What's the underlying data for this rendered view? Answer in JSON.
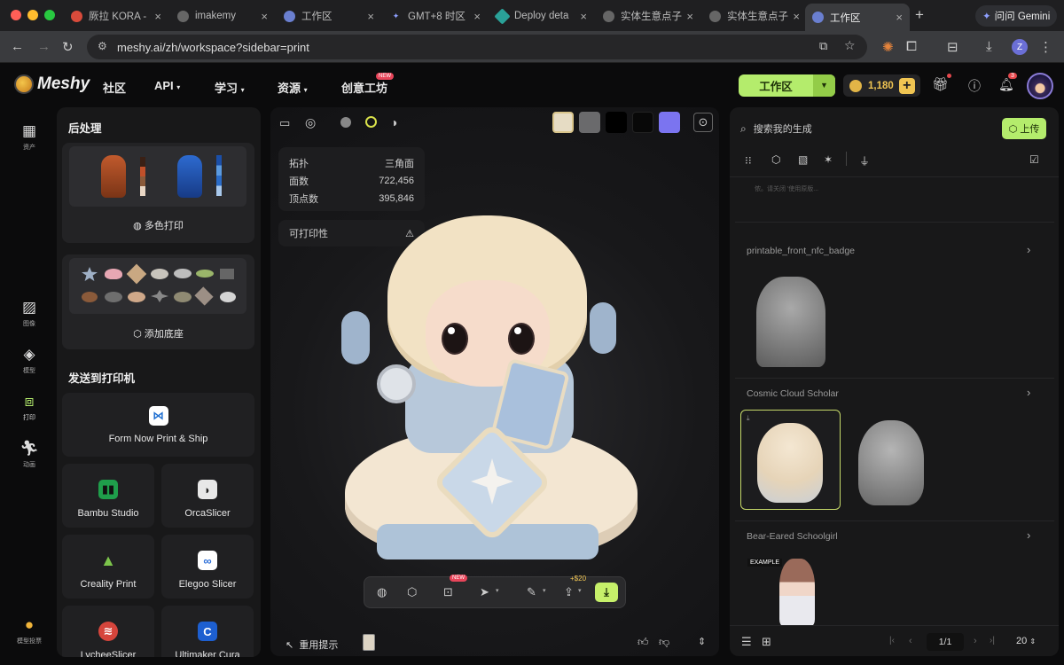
{
  "browser": {
    "tabs": [
      {
        "label": "厥拉 KORA -",
        "color": "#d94b3b"
      },
      {
        "label": "imakemy",
        "color": "#888"
      },
      {
        "label": "工作区",
        "color": "#6a7fd0"
      },
      {
        "label": "GMT+8 时区",
        "color": "#7b8cf0"
      },
      {
        "label": "Deploy deta",
        "color": "#2aa198"
      },
      {
        "label": "实体生意点子",
        "color": "#888"
      },
      {
        "label": "实体生意点子",
        "color": "#888"
      },
      {
        "label": "工作区",
        "color": "#6a7fd0"
      }
    ],
    "new_tab": "+",
    "gemini": "问问 Gemini",
    "url": "meshy.ai/zh/workspace?sidebar=print",
    "profile_initial": "Z"
  },
  "header": {
    "logo": "Meshy",
    "menu": [
      "社区",
      "API",
      "学习",
      "资源",
      "创意工坊"
    ],
    "menu_new_badge": "NEW",
    "workspace_button": "工作区",
    "credits": "1,180",
    "notif_count": "3"
  },
  "rail": {
    "items": [
      {
        "label": "资产",
        "icon": "grid-icon"
      },
      {
        "label": "图像",
        "icon": "image-icon"
      },
      {
        "label": "模型",
        "icon": "cube-icon"
      },
      {
        "label": "打印",
        "icon": "print-icon"
      },
      {
        "label": "动画",
        "icon": "run-icon"
      },
      {
        "label": "模型投票",
        "icon": "vote-icon"
      }
    ]
  },
  "left_panel": {
    "post_title": "后处理",
    "multicolor": "多色打印",
    "add_base": "添加底座",
    "send_title": "发送到打印机",
    "form_now": "Form Now Print & Ship",
    "slicers": [
      "Bambu Studio",
      "OrcaSlicer",
      "Creality Print",
      "Elegoo Slicer",
      "LycheeSlicer",
      "Ultimaker Cura"
    ]
  },
  "viewer": {
    "stats": [
      {
        "label": "拓扑",
        "value": "三角面"
      },
      {
        "label": "面数",
        "value": "722,456"
      },
      {
        "label": "顶点数",
        "value": "395,846"
      }
    ],
    "printability": "可打印性",
    "toolbar_new": "NEW",
    "toolbar_price": "+$20",
    "rerun_hint": "重用提示"
  },
  "right_panel": {
    "search_placeholder": "搜索我的生成",
    "upload": "上传",
    "faded_text": "侬。请关闭 '使用原版...",
    "results": [
      {
        "title": "printable_front_nfc_badge"
      },
      {
        "title": "Cosmic Cloud Scholar"
      },
      {
        "title": "Bear-Eared Schoolgirl",
        "badge": "EXAMPLE"
      }
    ],
    "page": "1/1",
    "page_size": "20"
  }
}
